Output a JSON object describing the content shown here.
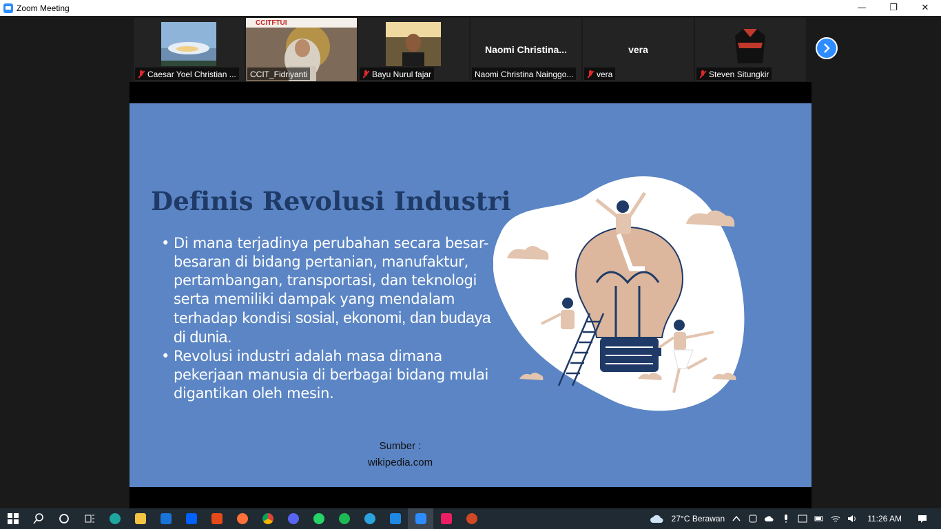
{
  "window": {
    "title": "Zoom Meeting",
    "controls": [
      "—",
      "❐",
      "✕"
    ]
  },
  "participants": [
    {
      "name": "Caesar Yoel Christian ...",
      "muted": true,
      "kind": "photo-sky"
    },
    {
      "name": "CCIT_Fidriyanti",
      "muted": false,
      "kind": "photo-presenter",
      "active": true,
      "logo_text": "CCITFTUI"
    },
    {
      "name": "Bayu Nurul fajar",
      "muted": true,
      "kind": "photo-person"
    },
    {
      "name": "Naomi Christina Nainggo...",
      "muted": false,
      "kind": "name-only",
      "display": "Naomi  Christina..."
    },
    {
      "name": "vera",
      "muted": true,
      "kind": "name-only",
      "display": "vera"
    },
    {
      "name": "Steven Situngkir",
      "muted": true,
      "kind": "photo-jersey"
    }
  ],
  "slide": {
    "title": "Definis Revolusi Industri",
    "bullet1_a": "Di mana terjadinya perubahan secara besar-besaran di bidang pertanian, manufaktur, pertambangan, transportasi, dan teknologi serta memiliki dampak yang mendalam terhadap kondisi ",
    "bullet1_b": "sosial, ekonomi, dan budaya di dunia",
    "bullet1_c": ".",
    "bullet2": "Revolusi industri adalah masa dimana pekerjaan manusia di berbagai bidang mulai digantikan oleh mesin.",
    "source_label": "Sumber :",
    "source_value": "wikipedia.com"
  },
  "taskbar": {
    "apps": [
      "start-icon",
      "search-icon",
      "cortana-icon",
      "task-view-icon",
      "edge-icon",
      "file-explorer-icon",
      "mail-icon",
      "dropbox-icon",
      "office-icon",
      "firefox-icon",
      "chrome-icon",
      "discord-icon",
      "whatsapp-icon",
      "spotify-icon",
      "telegram-icon",
      "vscode-icon",
      "zoom-icon",
      "app-icon",
      "powerpoint-icon"
    ],
    "weather": "27°C  Berawan",
    "time": "11:26 AM"
  },
  "colors": {
    "zoom_blue": "#2d8cff",
    "slide_bg": "#5b85c4",
    "title_color": "#1f3a66",
    "active_border": "#7fbf3f",
    "mic_red": "#e02828"
  }
}
